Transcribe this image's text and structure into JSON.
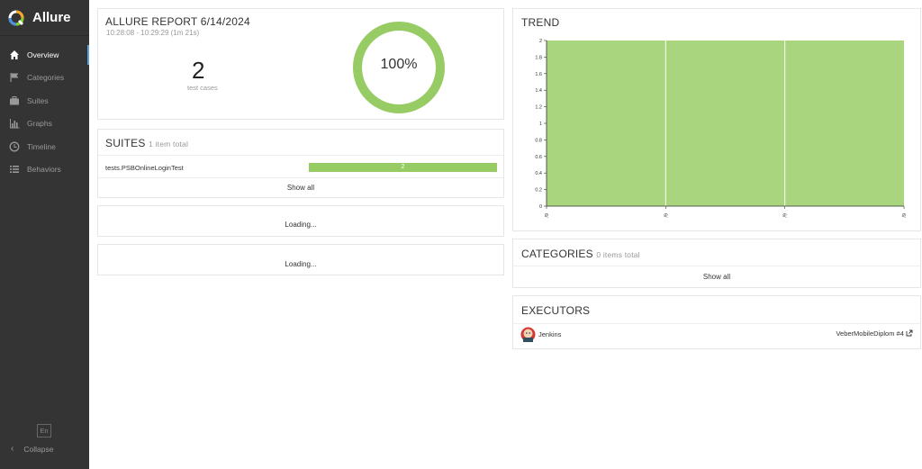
{
  "brand": {
    "name": "Allure"
  },
  "sidebar": {
    "items": [
      {
        "label": "Overview",
        "icon": "home-icon",
        "active": true
      },
      {
        "label": "Categories",
        "icon": "flag-icon",
        "active": false
      },
      {
        "label": "Suites",
        "icon": "briefcase-icon",
        "active": false
      },
      {
        "label": "Graphs",
        "icon": "bar-chart-icon",
        "active": false
      },
      {
        "label": "Timeline",
        "icon": "clock-icon",
        "active": false
      },
      {
        "label": "Behaviors",
        "icon": "list-icon",
        "active": false
      }
    ],
    "language": "En",
    "collapse_label": "Collapse"
  },
  "summary": {
    "title": "ALLURE REPORT 6/14/2024",
    "time_range": "10:28:08 - 10:29:29 (1m 21s)",
    "count": "2",
    "count_label": "test cases",
    "percent": "100%",
    "pass_fraction": 1.0
  },
  "suites": {
    "title": "SUITES",
    "subtitle": "1 item total",
    "rows": [
      {
        "name": "tests.PSBOnlineLoginTest",
        "count": "2",
        "passed_fraction": 1.0
      }
    ],
    "show_all": "Show all"
  },
  "loading1": "Loading...",
  "loading2": "Loading...",
  "trend": {
    "title": "TREND"
  },
  "chart_data": {
    "type": "area",
    "x": [
      "6/",
      "6/",
      "6/",
      "6/"
    ],
    "series": [
      {
        "values": [
          2,
          2,
          2,
          2
        ]
      }
    ],
    "yticks": [
      "0",
      "0.2",
      "0.4",
      "0.6",
      "0.8",
      "1",
      "1.2",
      "1.4",
      "1.6",
      "1.8",
      "2"
    ],
    "ylim": [
      0,
      2
    ],
    "xlabel": "",
    "ylabel": "",
    "grid": false
  },
  "categories": {
    "title": "CATEGORIES",
    "subtitle": "0 items total",
    "show_all": "Show all"
  },
  "executors": {
    "title": "EXECUTORS",
    "name": "Jenkins",
    "build": "VeberMobileDiplom #4"
  },
  "colors": {
    "passed": "#97cc64",
    "trend_fill": "#a8d57d",
    "sidebar_bg": "#343434",
    "active_accent": "#5aa0dc"
  }
}
